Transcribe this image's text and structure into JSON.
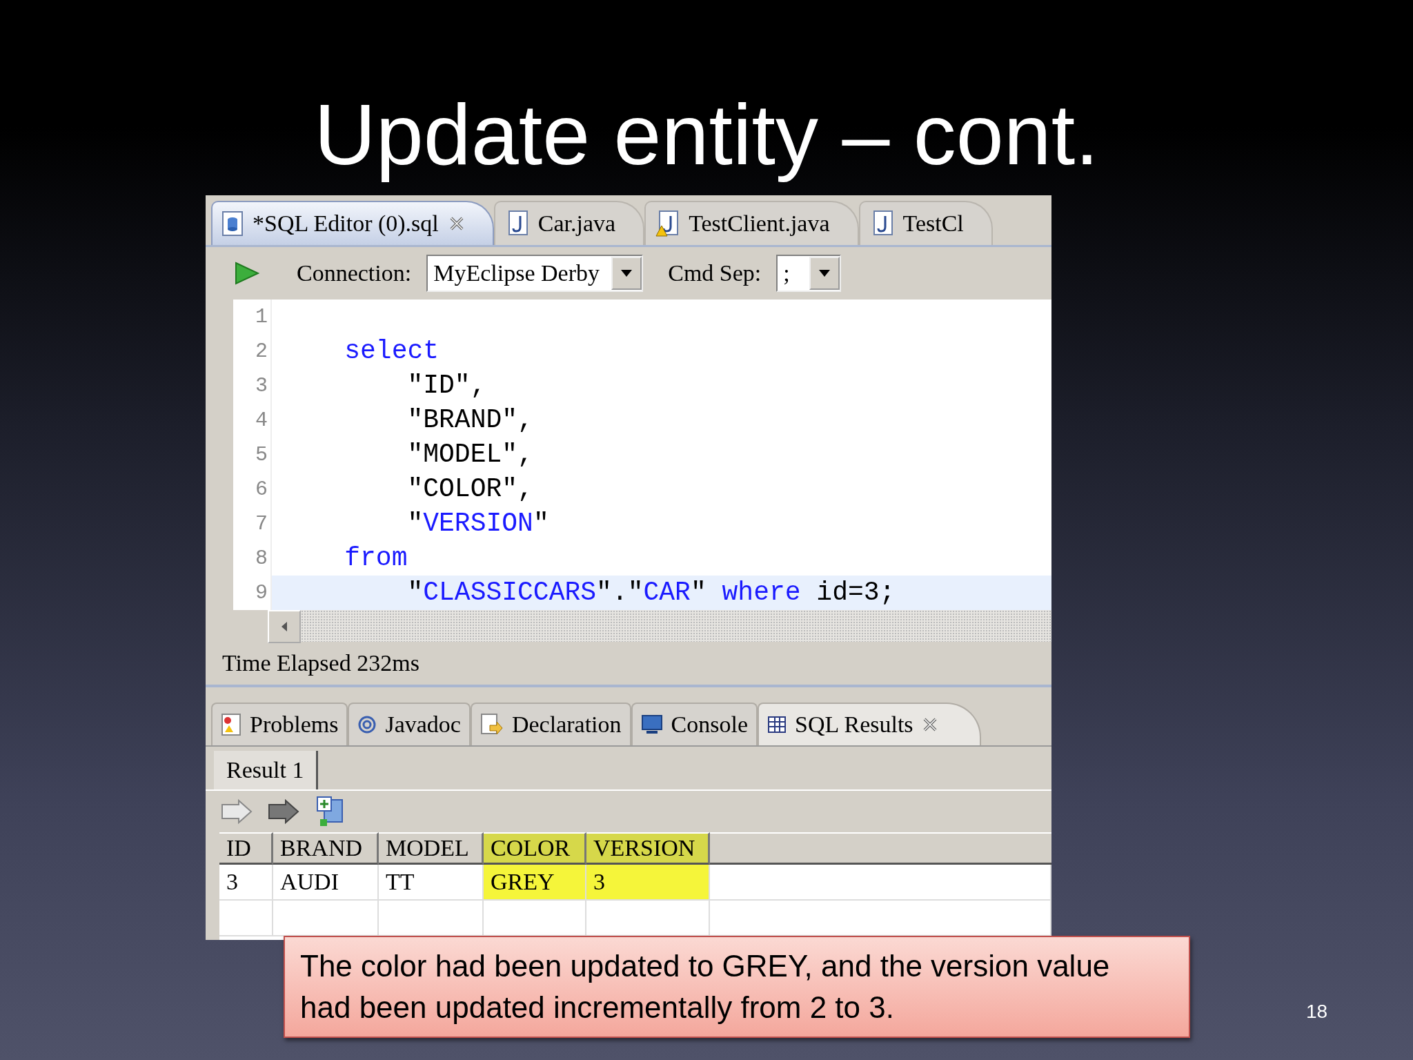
{
  "slide": {
    "title": "Update entity – cont.",
    "page_number": "18"
  },
  "editor_tabs": [
    {
      "label": "*SQL Editor (0).sql",
      "kind": "sql",
      "selected": true
    },
    {
      "label": "Car.java",
      "kind": "java",
      "selected": false
    },
    {
      "label": "TestClient.java",
      "kind": "java-warning",
      "selected": false
    },
    {
      "label": "TestCl",
      "kind": "java",
      "selected": false
    }
  ],
  "toolbar": {
    "connection_label": "Connection:",
    "connection_value": "MyEclipse Derby",
    "separator_label": "Cmd Sep:",
    "separator_value": ";"
  },
  "code_lines": [
    {
      "number": "1",
      "current": false
    },
    {
      "number": "2",
      "current": false,
      "tokens": [
        {
          "text": "    select",
          "kind": "keyword"
        }
      ]
    },
    {
      "number": "3",
      "current": false,
      "tokens": [
        {
          "text": "        \"ID\",",
          "kind": "plain"
        }
      ]
    },
    {
      "number": "4",
      "current": false,
      "tokens": [
        {
          "text": "        \"BRAND\",",
          "kind": "plain"
        }
      ]
    },
    {
      "number": "5",
      "current": false,
      "tokens": [
        {
          "text": "        \"MODEL\",",
          "kind": "plain"
        }
      ]
    },
    {
      "number": "6",
      "current": false,
      "tokens": [
        {
          "text": "        \"COLOR\",",
          "kind": "plain"
        }
      ]
    },
    {
      "number": "7",
      "current": false,
      "tokens": [
        {
          "text": "        \"",
          "kind": "plain"
        },
        {
          "text": "VERSION",
          "kind": "keyword"
        },
        {
          "text": "\"",
          "kind": "plain"
        }
      ]
    },
    {
      "number": "8",
      "current": false,
      "tokens": [
        {
          "text": "    from",
          "kind": "keyword"
        }
      ]
    },
    {
      "number": "9",
      "current": true,
      "tokens": [
        {
          "text": "        \"",
          "kind": "plain"
        },
        {
          "text": "CLASSICCARS",
          "kind": "keyword"
        },
        {
          "text": "\".\"",
          "kind": "plain"
        },
        {
          "text": "CAR",
          "kind": "keyword"
        },
        {
          "text": "\" ",
          "kind": "plain"
        },
        {
          "text": "where",
          "kind": "keyword"
        },
        {
          "text": " id=3;",
          "kind": "plain"
        }
      ]
    }
  ],
  "status": "Time Elapsed 232ms",
  "view_tabs": [
    {
      "label": "Problems",
      "kind": "problems",
      "selected": false
    },
    {
      "label": "Javadoc",
      "kind": "javadoc",
      "selected": false
    },
    {
      "label": "Declaration",
      "kind": "declaration",
      "selected": false
    },
    {
      "label": "Console",
      "kind": "console",
      "selected": false
    },
    {
      "label": "SQL Results",
      "kind": "grid",
      "selected": true
    }
  ],
  "result_tabs": [
    {
      "label": "Result 1",
      "selected": true
    }
  ],
  "results": {
    "columns": [
      {
        "label": "ID",
        "highlighted": false
      },
      {
        "label": "BRAND",
        "highlighted": false
      },
      {
        "label": "MODEL",
        "highlighted": false
      },
      {
        "label": "COLOR",
        "highlighted": true
      },
      {
        "label": "VERSION",
        "highlighted": true
      }
    ],
    "rows": [
      {
        "cells": [
          "3",
          "AUDI",
          "TT",
          "GREY",
          "3"
        ]
      }
    ]
  },
  "caption": "The color had been updated to GREY, and the version value had been updated incrementally from 2 to 3."
}
